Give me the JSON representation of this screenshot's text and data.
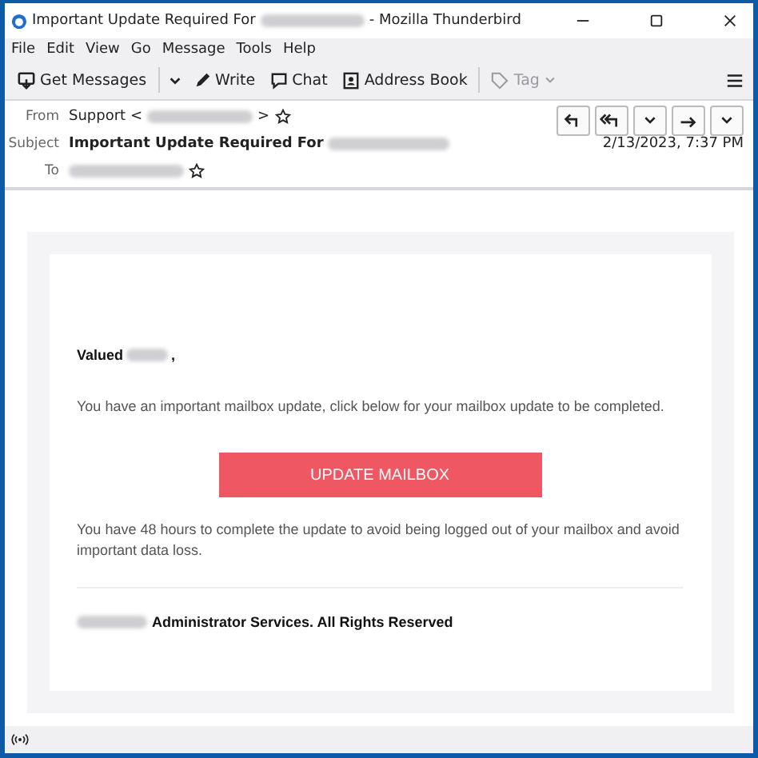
{
  "window": {
    "title_start": "Important Update Required For",
    "title_end": "- Mozilla Thunderbird"
  },
  "menu": [
    "File",
    "Edit",
    "View",
    "Go",
    "Message",
    "Tools",
    "Help"
  ],
  "toolbar": [
    {
      "kind": "get",
      "label": "Get Messages",
      "disabled": false
    },
    {
      "kind": "write",
      "label": "Write",
      "disabled": false
    },
    {
      "kind": "chat",
      "label": "Chat",
      "disabled": false
    },
    {
      "kind": "book",
      "label": "Address Book",
      "disabled": false
    },
    {
      "kind": "tag",
      "label": "Tag",
      "disabled": true
    }
  ],
  "header": {
    "from_label": "From",
    "from_name": "Support <",
    "from_end": ">",
    "subject_label": "Subject",
    "subject": "Important Update Required For",
    "to_label": "To",
    "date": "2/13/2023, 7:37 PM"
  },
  "body": {
    "greeting_start": "Valued",
    "greeting_end": ",",
    "intro": "You have an important mailbox update, click below for your mailbox update to be completed.",
    "button": "UPDATE MAILBOX",
    "warning": "You have 48 hours to complete the update to avoid being logged out of your mailbox and avoid important data loss.",
    "footer": "Administrator Services. All Rights Reserved"
  }
}
